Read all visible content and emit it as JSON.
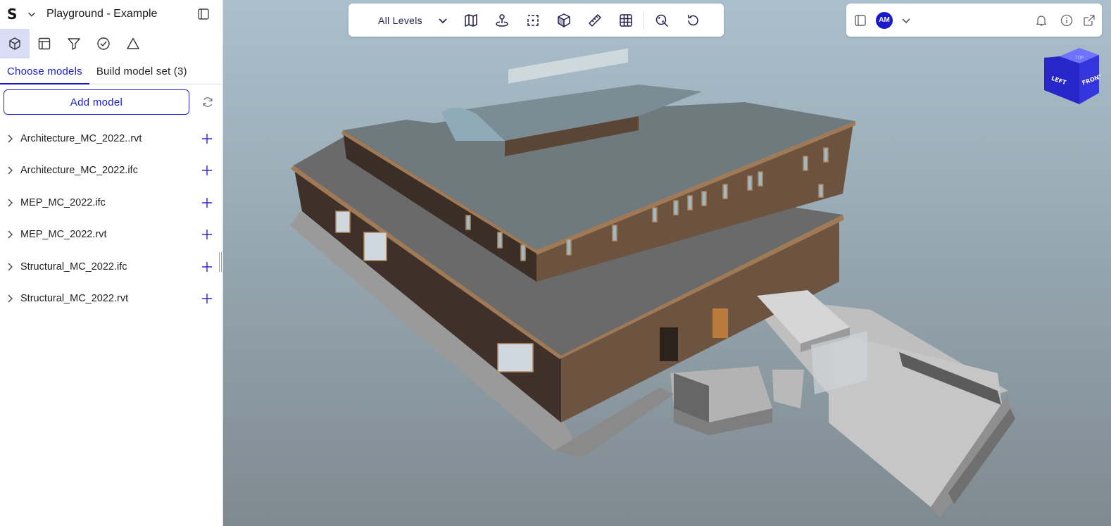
{
  "app": {
    "logo": "S",
    "project_title": "Playground - Example"
  },
  "tabs": [
    {
      "label": "Choose models",
      "active": true
    },
    {
      "label": "Build model set (3)",
      "active": false
    }
  ],
  "add_model_label": "Add model",
  "models": [
    {
      "name": "Architecture_MC_2022..rvt"
    },
    {
      "name": "Architecture_MC_2022.ifc"
    },
    {
      "name": "MEP_MC_2022.ifc"
    },
    {
      "name": "MEP_MC_2022.rvt"
    },
    {
      "name": "Structural_MC_2022.ifc"
    },
    {
      "name": "Structural_MC_2022.rvt"
    }
  ],
  "toolbar": {
    "levels_label": "All Levels",
    "tools": [
      "map-icon",
      "pin-icon",
      "select-box-icon",
      "section-cube-icon",
      "ruler-icon",
      "grid-icon",
      "zoom-fit-icon",
      "reset-icon"
    ]
  },
  "user": {
    "initials": "AM",
    "avatar_color": "#1a1acb"
  },
  "navcube": {
    "top": "TOP",
    "left": "LEFT",
    "front": "FRONT"
  },
  "colors": {
    "accent": "#1a1ad6",
    "wall": "#4a3a2e",
    "wall_light": "#7a6048",
    "roof": "#6e7a7d",
    "floor": "#777777"
  }
}
